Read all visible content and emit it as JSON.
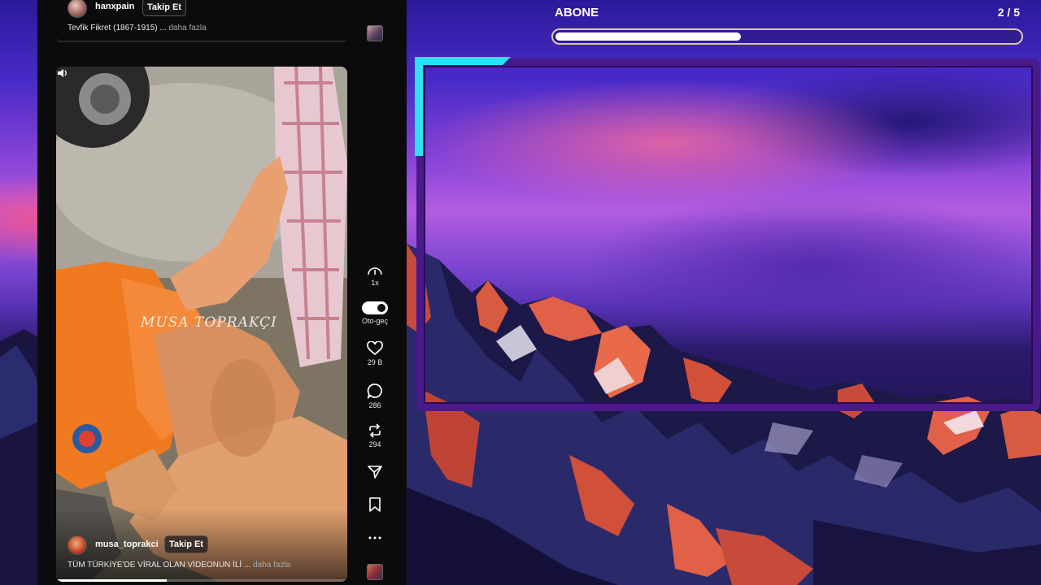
{
  "feed": {
    "top_post": {
      "username": "hanxpain",
      "follow_label": "Takip Et",
      "caption": "Tevfik Fikret (1867-1915) ...",
      "more_label": "daha fazla"
    },
    "video": {
      "watermark": "MUSA TOPRAKÇI",
      "username": "musa_toprakci",
      "follow_label": "Takip Et",
      "caption": "TÜM TÜRKİYE'DE VİRAL OLAN VİDEONUN İLİ ...",
      "more_label": "daha fazla",
      "progress_fraction": 0.38
    },
    "rail": {
      "speed_label": "1x",
      "autoplay_label": "Oto-geç",
      "likes": "29 B",
      "comments": "286",
      "reposts": "294"
    }
  },
  "overlay": {
    "title": "ABONE",
    "count": "2 / 5",
    "goal_fraction": 0.4,
    "colors": {
      "frame": "#4a1a8a",
      "accent": "#2ee0f0",
      "goal_border": "#d9c9a8"
    }
  }
}
